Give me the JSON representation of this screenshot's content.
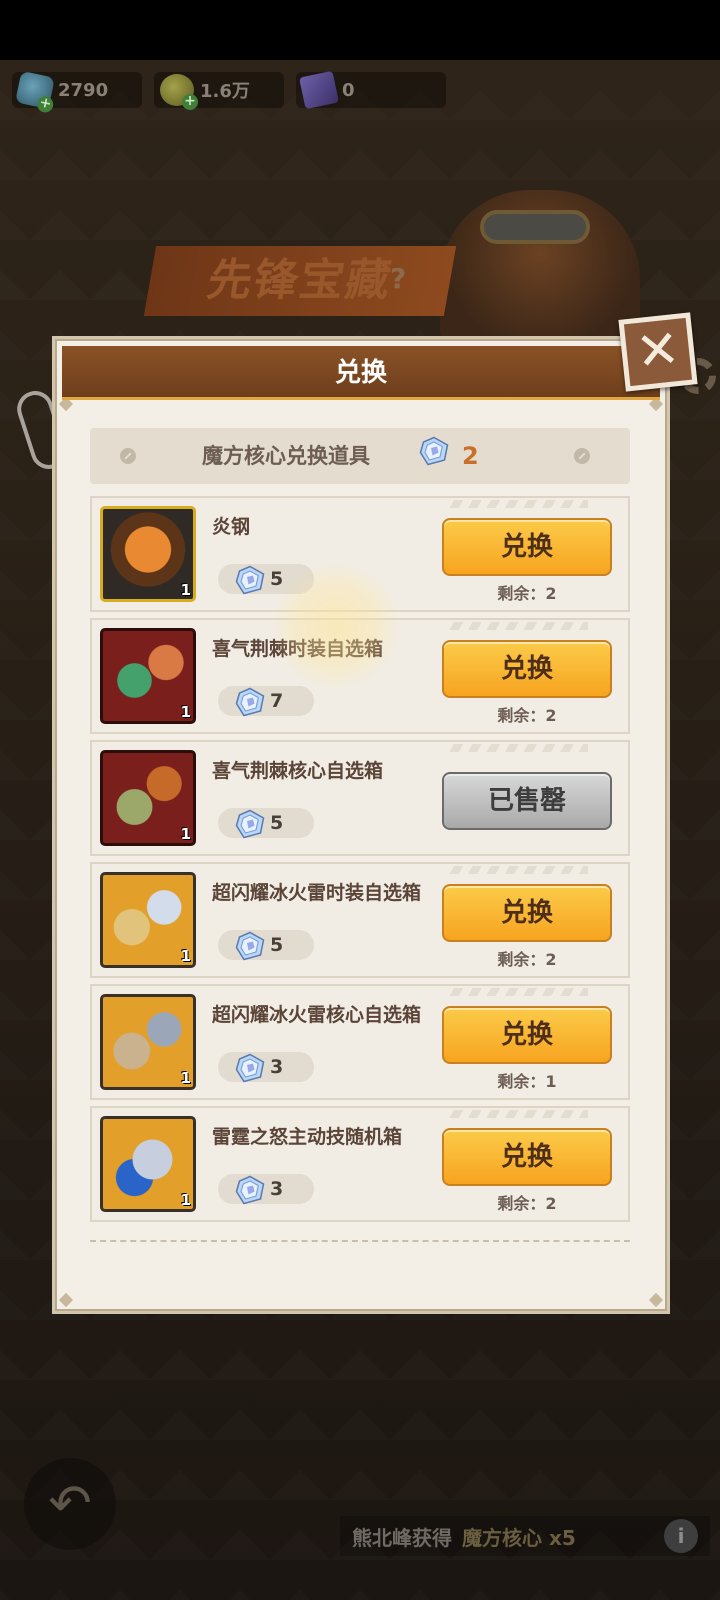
{
  "currencies": [
    {
      "value": "2790",
      "icon": "gem-icon"
    },
    {
      "value": "1.6万",
      "icon": "coin-icon"
    },
    {
      "value": "0",
      "icon": "card-icon"
    }
  ],
  "background": {
    "event_title": "先锋宝藏",
    "event_help": "?",
    "news_who": "熊北峰获得",
    "news_what": "魔方核心 x5",
    "info_icon": "i"
  },
  "modal": {
    "title": "兑换",
    "close_glyph": "✕",
    "core_label": "魔方核心兑换道具",
    "core_count": "2",
    "items": [
      {
        "name": "炎钢",
        "cost": "5",
        "qty": "1",
        "button": "兑换",
        "remain": "剩余：2",
        "sold_out": false
      },
      {
        "name": "喜气荆棘时装自选箱",
        "cost": "7",
        "qty": "1",
        "button": "兑换",
        "remain": "剩余：2",
        "sold_out": false
      },
      {
        "name": "喜气荆棘核心自选箱",
        "cost": "5",
        "qty": "1",
        "button": "已售罄",
        "remain": "",
        "sold_out": true
      },
      {
        "name": "超闪耀冰火雷时装自选箱",
        "cost": "5",
        "qty": "1",
        "button": "兑换",
        "remain": "剩余：2",
        "sold_out": false
      },
      {
        "name": "超闪耀冰火雷核心自选箱",
        "cost": "3",
        "qty": "1",
        "button": "兑换",
        "remain": "剩余：1",
        "sold_out": false
      },
      {
        "name": "雷霆之怒主动技随机箱",
        "cost": "3",
        "qty": "1",
        "button": "兑换",
        "remain": "剩余：2",
        "sold_out": false
      }
    ]
  },
  "colors": {
    "button_yellow": "#f7a420",
    "button_gray": "#a9a9a9",
    "header_brown": "#7a4520",
    "accent_orange": "#c8702a"
  }
}
